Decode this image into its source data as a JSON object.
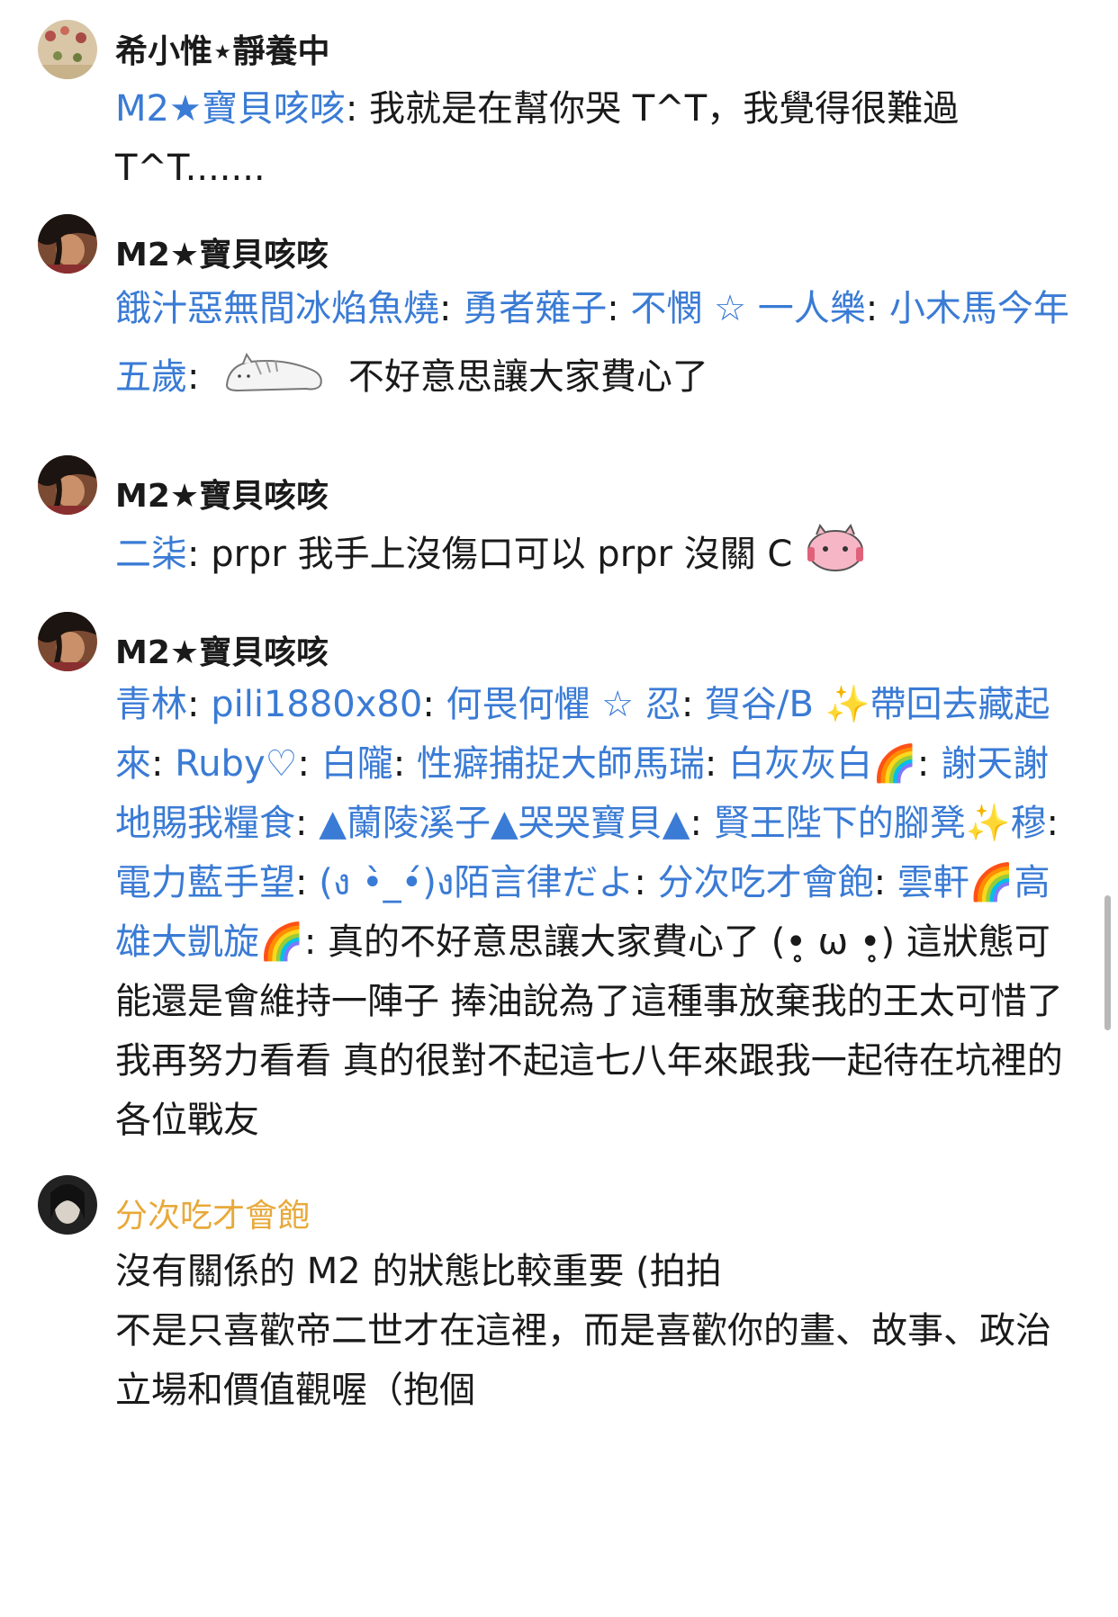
{
  "comments": [
    {
      "author": "希小惟⋆靜養中",
      "mentions": [
        "M2★寶貝咳咳"
      ],
      "text": "我就是在幫你哭 T^T，我覺得很難過T^T......."
    },
    {
      "author": "M2★寶貝咳咳",
      "mentions": [
        "餓汁惡無間冰焰魚燒",
        "勇者薙子",
        "不憫 ☆ 一人樂",
        "小木馬今年五歲"
      ],
      "sticker": "lying-cat-sticker",
      "text": "不好意思讓大家費心了"
    },
    {
      "author": "M2★寶貝咳咳",
      "mentions": [
        "二柒"
      ],
      "text": "prpr 我手上沒傷口可以 prpr 沒關 C",
      "sticker": "pink-blob-sticker"
    },
    {
      "author": "M2★寶貝咳咳",
      "mentions": [
        "青林",
        "pili1880x80",
        "何畏何懼 ☆ 忍",
        "賀谷/B ✨帶回去藏起來",
        "Ruby♡",
        "白隴",
        "性癖捕捉大師馬瑞",
        "白灰灰白🌈",
        "謝天謝地賜我糧食",
        "▲蘭陵溪子▲哭哭寶貝▲",
        "賢王陛下的腳凳✨穆",
        "電力藍手望",
        "(ง •̀_•́)ง陌言律だよ",
        "分次吃才會飽",
        "雲軒🌈高雄大凱旋🌈"
      ],
      "text": "真的不好意思讓大家費心了 (•̥ ω •̥) 這狀態可能還是會維持一陣子 捧油說為了這種事放棄我的王太可惜了 我再努力看看 真的很對不起這七八年來跟我一起待在坑裡的各位戰友"
    },
    {
      "author": "分次吃才會飽",
      "text_lines": [
        "沒有關係的 M2 的狀態比較重要 (拍拍",
        "不是只喜歡帝二世才在這裡，而是喜歡你的畫、故事、政治立場和價值觀喔（抱個"
      ]
    }
  ],
  "colors": {
    "mention": "#3a7bd5",
    "gold_author": "#e8a93a",
    "text": "#1a1a1a"
  }
}
